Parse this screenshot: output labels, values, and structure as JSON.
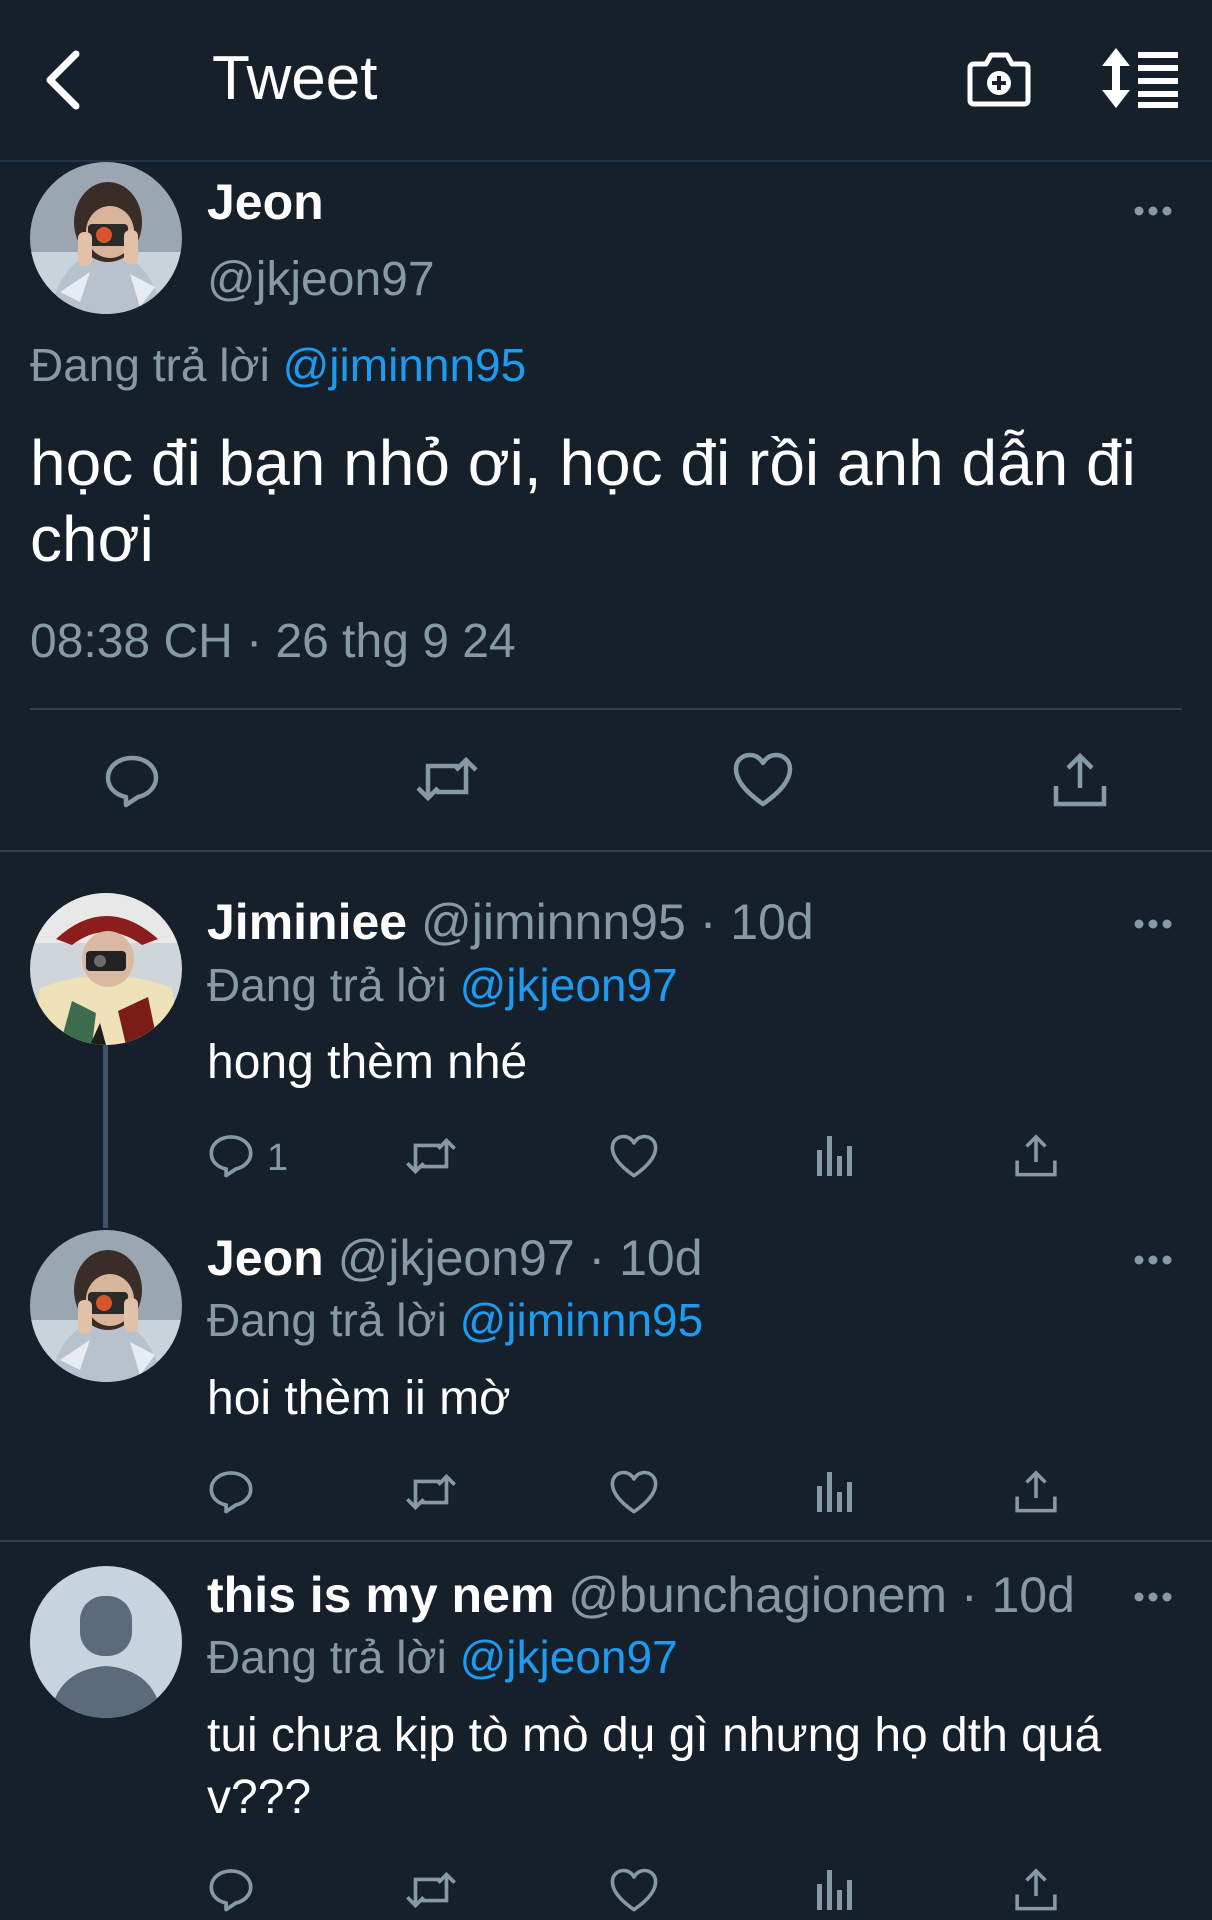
{
  "header": {
    "title": "Tweet",
    "back_icon": "back-arrow-icon",
    "camera_icon": "camera-plus-icon",
    "sort_icon": "sort-replies-icon"
  },
  "main_tweet": {
    "name": "Jeon",
    "handle": "@jkjeon97",
    "reply_prefix": "Đang trả lời",
    "reply_to": "@jiminnn95",
    "text": "học đi bạn nhỏ ơi, học đi rồi anh dẫn đi chơi",
    "timestamp": "08:38 CH · 26 thg 9 24"
  },
  "replies": [
    {
      "name": "Jiminiee",
      "handle": "@jiminnn95",
      "time": "· 10d",
      "reply_prefix": "Đang trả lời",
      "reply_to": "@jkjeon97",
      "text": "hong thèm nhé",
      "reply_count": "1"
    },
    {
      "name": "Jeon",
      "handle": "@jkjeon97",
      "time": "· 10d",
      "reply_prefix": "Đang trả lời",
      "reply_to": "@jiminnn95",
      "text": "hoi thèm ii mờ",
      "reply_count": ""
    },
    {
      "name": "this is my nem",
      "handle": "@bunchagionem",
      "time": "· 10d",
      "reply_prefix": "Đang trả lời",
      "reply_to": "@jkjeon97",
      "text": "tui chưa kịp tò mò dụ gì nhưng họ dth quá v???",
      "reply_count": ""
    }
  ],
  "colors": {
    "background": "#15202b",
    "accent": "#1d9bf0",
    "secondary_text": "#8899a6",
    "divider": "#2f3f50"
  }
}
